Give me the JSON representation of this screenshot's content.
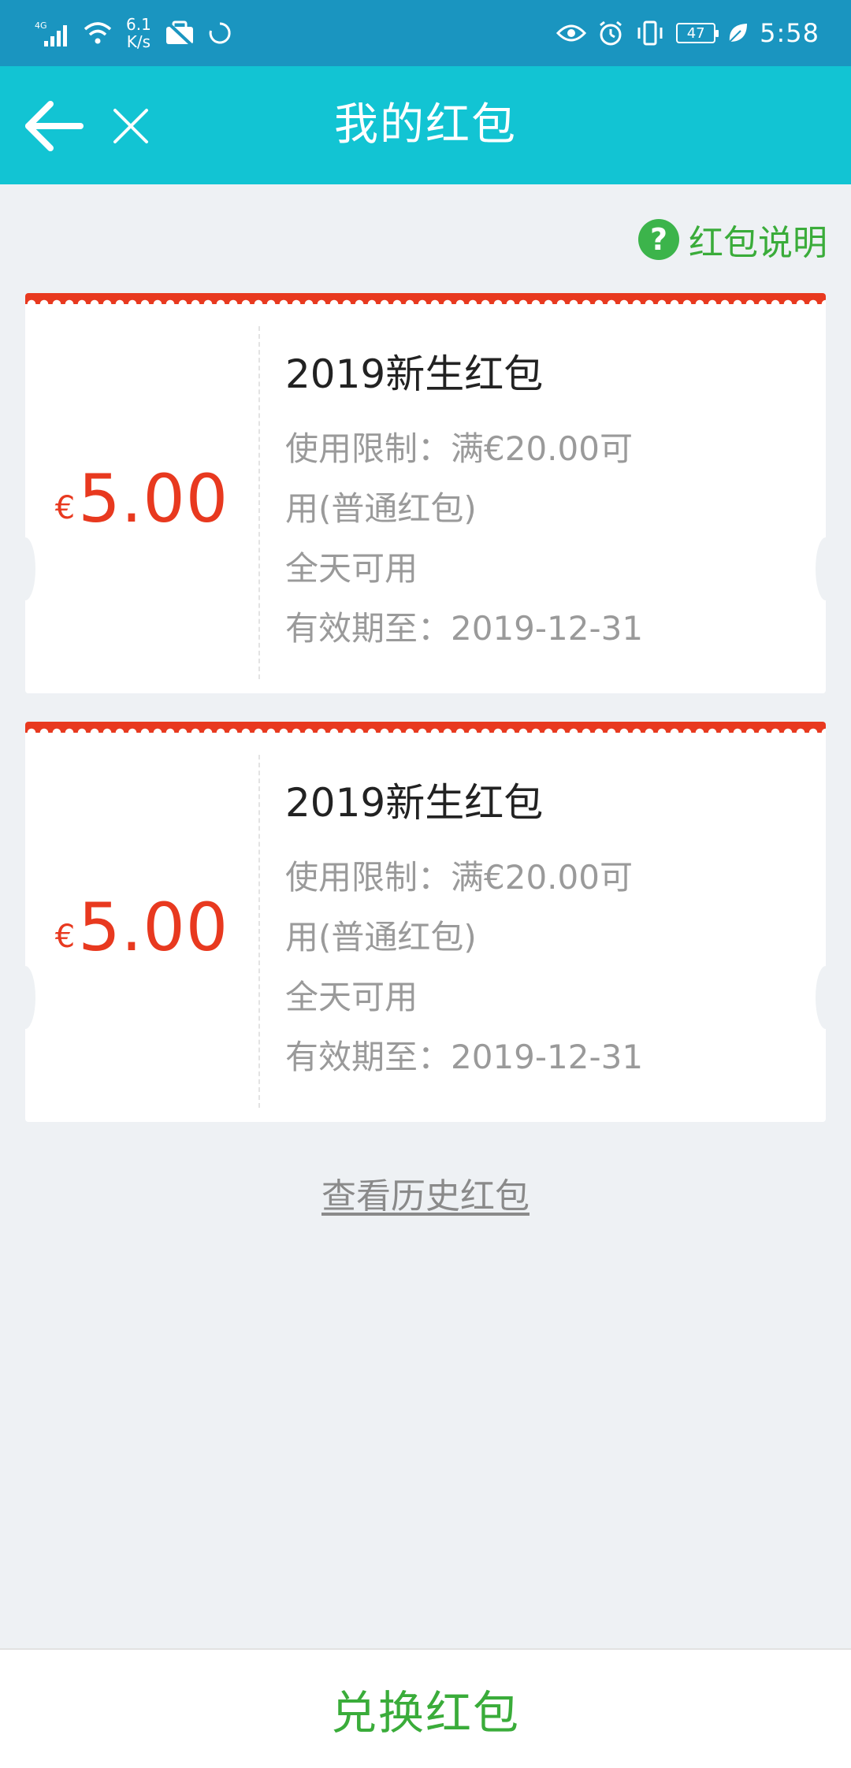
{
  "status_bar": {
    "signal_label": "4G",
    "net_speed_value": "6.1",
    "net_speed_unit": "K/s",
    "battery": "47",
    "time": "5:58",
    "icons": [
      "signal-icon",
      "wifi-icon",
      "notification-icon",
      "sync-icon",
      "eye-icon",
      "alarm-icon",
      "vibrate-icon",
      "battery-icon",
      "leaf-icon"
    ]
  },
  "header": {
    "title": "我的红包",
    "back_icon": "back-arrow-icon",
    "close_icon": "close-icon",
    "bg_color": "#12c4d3"
  },
  "help": {
    "label": "红包说明",
    "icon_glyph": "?",
    "color": "#3aac3a"
  },
  "coupons": [
    {
      "currency": "€",
      "amount": "5.00",
      "title": "2019新生红包",
      "limit_line1": "使用限制：满€20.00可",
      "limit_line2": "用(普通红包)",
      "time_rule": "全天可用",
      "expiry": "有效期至：2019-12-31"
    },
    {
      "currency": "€",
      "amount": "5.00",
      "title": "2019新生红包",
      "limit_line1": "使用限制：满€20.00可",
      "limit_line2": "用(普通红包)",
      "time_rule": "全天可用",
      "expiry": "有效期至：2019-12-31"
    }
  ],
  "history_link": "查看历史红包",
  "bottom": {
    "redeem_label": "兑换红包"
  },
  "colors": {
    "accent_red": "#e8391f",
    "accent_green": "#3aac3a",
    "status_bar": "#1a95c0",
    "page_bg": "#eef1f4"
  }
}
